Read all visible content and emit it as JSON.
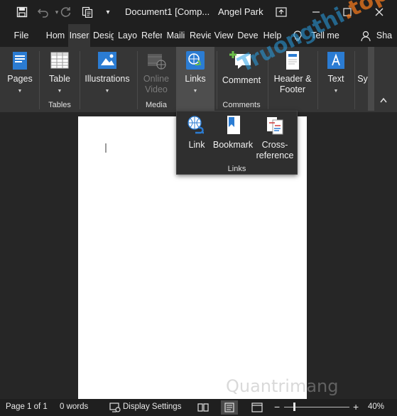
{
  "titlebar": {
    "save_icon": "save-icon",
    "undo_icon": "undo-icon",
    "redo_icon": "redo-icon",
    "format_icon": "format-painter-icon",
    "customize_icon": "customize-quick-access-icon",
    "document_title": "Document1 [Comp...",
    "user_name": "Angel Park",
    "ribbon_display_icon": "ribbon-display-options-icon",
    "minimize_icon": "minimize-icon",
    "maximize_icon": "maximize-icon",
    "close_icon": "close-icon"
  },
  "tabs": [
    {
      "label": "File"
    },
    {
      "label": "Hom"
    },
    {
      "label": "Inser"
    },
    {
      "label": "Desig"
    },
    {
      "label": "Layo"
    },
    {
      "label": "Refer"
    },
    {
      "label": "Maili"
    },
    {
      "label": "Revie"
    },
    {
      "label": "View"
    },
    {
      "label": "Deve"
    },
    {
      "label": "Help"
    }
  ],
  "tellme": {
    "label": "Tell me",
    "icon": "lightbulb-icon"
  },
  "share": {
    "label": "Sha",
    "icon": "person-icon"
  },
  "ribbon": {
    "pages": {
      "label": "Pages"
    },
    "table": {
      "label": "Table"
    },
    "tables_group": "Tables",
    "illustrations": {
      "label": "Illustrations"
    },
    "online_video": {
      "line1": "Online",
      "line2": "Video"
    },
    "media_group": "Media",
    "links": {
      "label": "Links"
    },
    "comment": {
      "label": "Comment"
    },
    "comments_group": "Comments",
    "header_footer": {
      "line1": "Header &",
      "line2": "Footer"
    },
    "text": {
      "label": "Text"
    },
    "symbols": {
      "label": "Sy"
    }
  },
  "links_dropdown": {
    "link": {
      "label": "Link"
    },
    "bookmark": {
      "label": "Bookmark"
    },
    "cross_reference": {
      "line1": "Cross-",
      "line2": "reference"
    },
    "group_label": "Links"
  },
  "statusbar": {
    "page": "Page 1 of 1",
    "words": "0 words",
    "display_settings": "Display Settings",
    "zoom_minus": "−",
    "zoom_plus": "+",
    "zoom_level": "40%"
  },
  "watermark": {
    "top_main": "Truongthi",
    "top_dot": ".",
    "top_tail": "top",
    "bottom": "Quantrimang"
  },
  "colors": {
    "background": "#262626",
    "ribbon": "#363636",
    "titlebar": "#1f1f1f",
    "accent_blue": "#2b7cd3",
    "link_green": "#6cc04a"
  }
}
